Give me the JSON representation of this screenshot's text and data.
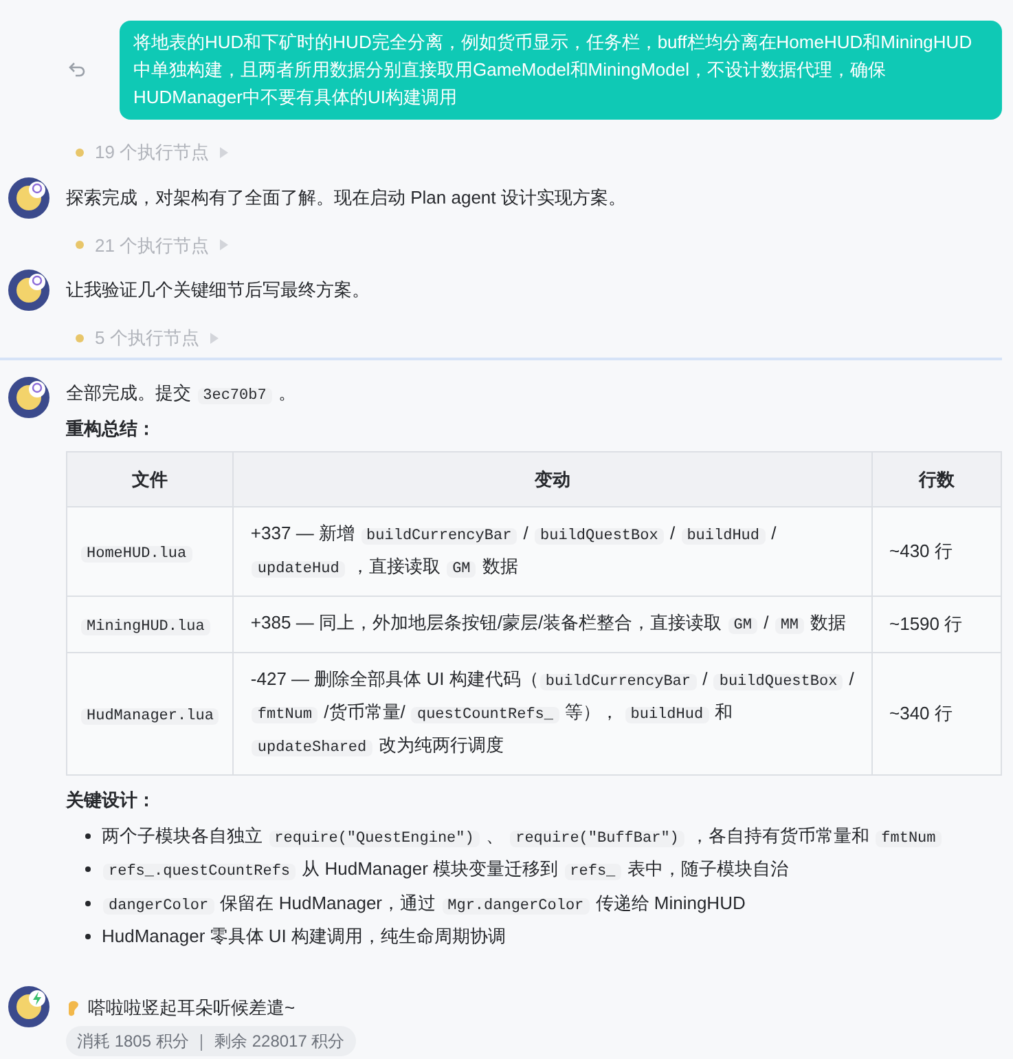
{
  "user_message": {
    "text": "将地表的HUD和下矿时的HUD完全分离，例如货币显示，任务栏，buff栏均分离在HomeHUD和MiningHUD中单独构建，且两者所用数据分别直接取用GameModel和MiningModel，不设计数据代理，确保HUDManager中不要有具体的UI构建调用"
  },
  "messages": [
    {
      "steps": "19 个执行节点",
      "text": "探索完成，对架构有了全面了解。现在启动 Plan agent 设计实现方案。"
    },
    {
      "steps": "21 个执行节点",
      "text": "让我验证几个关键细节后写最终方案。"
    }
  ],
  "hidden_steps": "5 个执行节点",
  "summary": {
    "intro": [
      {
        "kind": "text",
        "text": "全部完成。提交 "
      },
      {
        "kind": "code",
        "text": "3ec70b7"
      },
      {
        "kind": "text",
        "text": " 。"
      }
    ],
    "heading": "重构总结：",
    "table": {
      "columns": [
        "文件",
        "变动",
        "行数"
      ],
      "rows": [
        {
          "file": "HomeHUD.lua",
          "change": [
            {
              "kind": "text",
              "text": "+337 — 新增 "
            },
            {
              "kind": "code",
              "text": "buildCurrencyBar"
            },
            {
              "kind": "text",
              "text": " / "
            },
            {
              "kind": "code",
              "text": "buildQuestBox"
            },
            {
              "kind": "text",
              "text": " / "
            },
            {
              "kind": "code",
              "text": "buildHud"
            },
            {
              "kind": "text",
              "text": " / "
            },
            {
              "kind": "code",
              "text": "updateHud"
            },
            {
              "kind": "text",
              "text": " ，直接读取 "
            },
            {
              "kind": "code",
              "text": "GM"
            },
            {
              "kind": "text",
              "text": " 数据"
            }
          ],
          "lines": "~430 行"
        },
        {
          "file": "MiningHUD.lua",
          "change": [
            {
              "kind": "text",
              "text": "+385 — 同上，外加地层条按钮/蒙层/装备栏整合，直接读取 "
            },
            {
              "kind": "code",
              "text": "GM"
            },
            {
              "kind": "text",
              "text": " / "
            },
            {
              "kind": "code",
              "text": "MM"
            },
            {
              "kind": "text",
              "text": " 数据"
            }
          ],
          "lines": "~1590 行"
        },
        {
          "file": "HudManager.lua",
          "change": [
            {
              "kind": "text",
              "text": "-427 — 删除全部具体 UI 构建代码（"
            },
            {
              "kind": "code",
              "text": "buildCurrencyBar"
            },
            {
              "kind": "text",
              "text": " / "
            },
            {
              "kind": "code",
              "text": "buildQuestBox"
            },
            {
              "kind": "text",
              "text": " / "
            },
            {
              "kind": "code",
              "text": "fmtNum"
            },
            {
              "kind": "text",
              "text": " /货币常量/ "
            },
            {
              "kind": "code",
              "text": "questCountRefs_"
            },
            {
              "kind": "text",
              "text": " 等）， "
            },
            {
              "kind": "code",
              "text": "buildHud"
            },
            {
              "kind": "text",
              "text": " 和 "
            },
            {
              "kind": "code",
              "text": "updateShared"
            },
            {
              "kind": "text",
              "text": " 改为纯两行调度"
            }
          ],
          "lines": "~340 行"
        }
      ]
    },
    "design_heading": "关键设计：",
    "bullets": [
      [
        {
          "kind": "text",
          "text": "两个子模块各自独立 "
        },
        {
          "kind": "code",
          "text": "require(\"QuestEngine\")"
        },
        {
          "kind": "text",
          "text": " 、 "
        },
        {
          "kind": "code",
          "text": "require(\"BuffBar\")"
        },
        {
          "kind": "text",
          "text": " ，各自持有货币常量和 "
        },
        {
          "kind": "code",
          "text": "fmtNum"
        }
      ],
      [
        {
          "kind": "code",
          "text": "refs_.questCountRefs"
        },
        {
          "kind": "text",
          "text": " 从 HudManager 模块变量迁移到 "
        },
        {
          "kind": "code",
          "text": "refs_"
        },
        {
          "kind": "text",
          "text": " 表中，随子模块自治"
        }
      ],
      [
        {
          "kind": "code",
          "text": "dangerColor"
        },
        {
          "kind": "text",
          "text": " 保留在 HudManager，通过 "
        },
        {
          "kind": "code",
          "text": "Mgr.dangerColor"
        },
        {
          "kind": "text",
          "text": " 传递给 MiningHUD"
        }
      ],
      [
        {
          "kind": "text",
          "text": "HudManager 零具体 UI 构建调用，纯生命周期协调"
        }
      ]
    ]
  },
  "final": {
    "text": "嗒啦啦竖起耳朵听候差遣~",
    "usage": "消耗 1805 积分 ｜ 剩余 228017 积分"
  }
}
